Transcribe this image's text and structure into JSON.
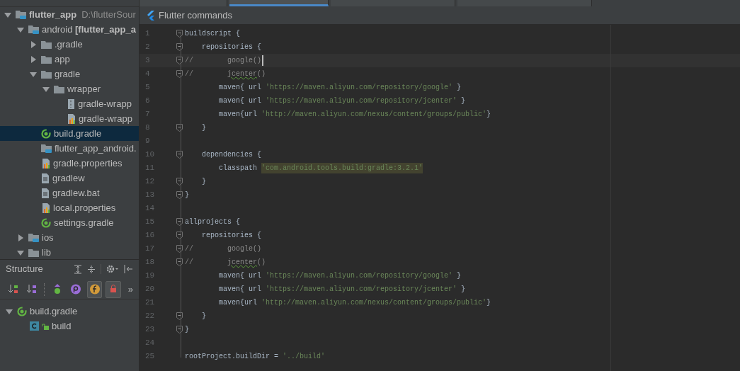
{
  "editor_tabs": [
    {
      "selected": false
    },
    {
      "selected": true
    },
    {
      "selected": false
    },
    {
      "selected": false
    }
  ],
  "project_tree": [
    {
      "label": "flutter_app",
      "bold": true,
      "path": "D:\\flutterSour",
      "kind": "module",
      "expanded": true,
      "selected": false,
      "children": [
        {
          "label": "android **[flutter_app_a**",
          "kind": "module",
          "expanded": true,
          "selected": false,
          "children": [
            {
              "label": ".gradle",
              "kind": "folder",
              "expanded": false,
              "selected": false
            },
            {
              "label": "app",
              "kind": "folder",
              "expanded": false,
              "selected": false
            },
            {
              "label": "gradle",
              "kind": "folder",
              "expanded": true,
              "selected": false,
              "children": [
                {
                  "label": "wrapper",
                  "kind": "folder",
                  "expanded": true,
                  "selected": false,
                  "children": [
                    {
                      "label": "gradle-wrapp",
                      "kind": "archive",
                      "selected": false
                    },
                    {
                      "label": "gradle-wrapp",
                      "kind": "properties",
                      "selected": false
                    }
                  ]
                }
              ]
            },
            {
              "label": "build.gradle",
              "kind": "gradle",
              "selected": true
            },
            {
              "label": "flutter_app_android.",
              "kind": "module",
              "selected": false
            },
            {
              "label": "gradle.properties",
              "kind": "properties",
              "selected": false
            },
            {
              "label": "gradlew",
              "kind": "file",
              "selected": false
            },
            {
              "label": "gradlew.bat",
              "kind": "file",
              "selected": false
            },
            {
              "label": "local.properties",
              "kind": "properties",
              "selected": false
            },
            {
              "label": "settings.gradle",
              "kind": "gradle",
              "selected": false
            }
          ]
        },
        {
          "label": "ios",
          "kind": "module",
          "expanded": false,
          "selected": false
        },
        {
          "label": "lib",
          "kind": "folder",
          "expanded": true,
          "selected": false
        }
      ]
    }
  ],
  "structure": {
    "title": "Structure",
    "buttons": [
      {
        "kind": "sort-visibility",
        "selected": false
      },
      {
        "kind": "sort-alpha",
        "selected": false
      },
      {
        "kind": "inherited",
        "selected": false
      },
      {
        "kind": "properties",
        "selected": false
      },
      {
        "kind": "fields",
        "selected": true
      },
      {
        "kind": "non-public",
        "selected": true
      }
    ],
    "overflow": "»",
    "tree": [
      {
        "label": "build.gradle",
        "kind": "gradle",
        "expanded": true,
        "children": [
          {
            "label": "build",
            "kind": "class"
          }
        ]
      }
    ]
  },
  "flutter_bar": {
    "label": "Flutter commands"
  },
  "code_lines": [
    {
      "n": "1",
      "fold": true,
      "tokens": [
        {
          "kind": "plain",
          "text": "buildscript {"
        }
      ]
    },
    {
      "n": "2",
      "fold": true,
      "tokens": [
        {
          "kind": "plain",
          "text": "    repositories {"
        }
      ]
    },
    {
      "n": "3",
      "fold": true,
      "current": true,
      "caret": true,
      "tokens": [
        {
          "kind": "comment",
          "text": "//"
        },
        {
          "kind": "muted",
          "text": "        google()"
        }
      ]
    },
    {
      "n": "4",
      "fold": true,
      "tokens": [
        {
          "kind": "comment",
          "text": "//        "
        },
        {
          "kind": "typo",
          "text": "jcenter"
        },
        {
          "kind": "muted",
          "text": "()"
        }
      ]
    },
    {
      "n": "5",
      "tokens": [
        {
          "kind": "plain",
          "text": "        maven{ url "
        },
        {
          "kind": "string",
          "text": "'https://maven.aliyun.com/repository/google'"
        },
        {
          "kind": "plain",
          "text": " }"
        }
      ]
    },
    {
      "n": "6",
      "tokens": [
        {
          "kind": "plain",
          "text": "        maven{ url "
        },
        {
          "kind": "string",
          "text": "'https://maven.aliyun.com/repository/jcenter'"
        },
        {
          "kind": "plain",
          "text": " }"
        }
      ]
    },
    {
      "n": "7",
      "tokens": [
        {
          "kind": "plain",
          "text": "        maven{url "
        },
        {
          "kind": "string",
          "text": "'http://maven.aliyun.com/nexus/content/groups/public'"
        },
        {
          "kind": "plain",
          "text": "}"
        }
      ]
    },
    {
      "n": "8",
      "fold": true,
      "tokens": [
        {
          "kind": "plain",
          "text": "    }"
        }
      ]
    },
    {
      "n": "9"
    },
    {
      "n": "10",
      "fold": true,
      "tokens": [
        {
          "kind": "plain",
          "text": "    dependencies {"
        }
      ]
    },
    {
      "n": "11",
      "tokens": [
        {
          "kind": "plain",
          "text": "        classpath "
        },
        {
          "kind": "highlight",
          "text": "'com.android.tools.build:gradle:3.2.1'"
        }
      ]
    },
    {
      "n": "12",
      "fold": true,
      "tokens": [
        {
          "kind": "plain",
          "text": "    }"
        }
      ]
    },
    {
      "n": "13",
      "fold": true,
      "tokens": [
        {
          "kind": "plain",
          "text": "}"
        }
      ]
    },
    {
      "n": "14"
    },
    {
      "n": "15",
      "fold": true,
      "tokens": [
        {
          "kind": "plain",
          "text": "allprojects {"
        }
      ]
    },
    {
      "n": "16",
      "fold": true,
      "tokens": [
        {
          "kind": "plain",
          "text": "    repositories {"
        }
      ]
    },
    {
      "n": "17",
      "fold": true,
      "tokens": [
        {
          "kind": "comment",
          "text": "//"
        },
        {
          "kind": "muted",
          "text": "        google()"
        }
      ]
    },
    {
      "n": "18",
      "fold": true,
      "tokens": [
        {
          "kind": "comment",
          "text": "//        "
        },
        {
          "kind": "typo",
          "text": "jcenter"
        },
        {
          "kind": "muted",
          "text": "()"
        }
      ]
    },
    {
      "n": "19",
      "tokens": [
        {
          "kind": "plain",
          "text": "        maven{ url "
        },
        {
          "kind": "string",
          "text": "'https://maven.aliyun.com/repository/google'"
        },
        {
          "kind": "plain",
          "text": " }"
        }
      ]
    },
    {
      "n": "20",
      "tokens": [
        {
          "kind": "plain",
          "text": "        maven{ url "
        },
        {
          "kind": "string",
          "text": "'https://maven.aliyun.com/repository/jcenter'"
        },
        {
          "kind": "plain",
          "text": " }"
        }
      ]
    },
    {
      "n": "21",
      "tokens": [
        {
          "kind": "plain",
          "text": "        maven{url "
        },
        {
          "kind": "string",
          "text": "'http://maven.aliyun.com/nexus/content/groups/public'"
        },
        {
          "kind": "plain",
          "text": "}"
        }
      ]
    },
    {
      "n": "22",
      "fold": true,
      "tokens": [
        {
          "kind": "plain",
          "text": "    }"
        }
      ]
    },
    {
      "n": "23",
      "fold": true,
      "tokens": [
        {
          "kind": "plain",
          "text": "}"
        }
      ]
    },
    {
      "n": "24"
    },
    {
      "n": "25",
      "tokens": [
        {
          "kind": "plain",
          "text": "rootProject.buildDir = "
        },
        {
          "kind": "string",
          "text": "'../build'"
        }
      ]
    }
  ]
}
